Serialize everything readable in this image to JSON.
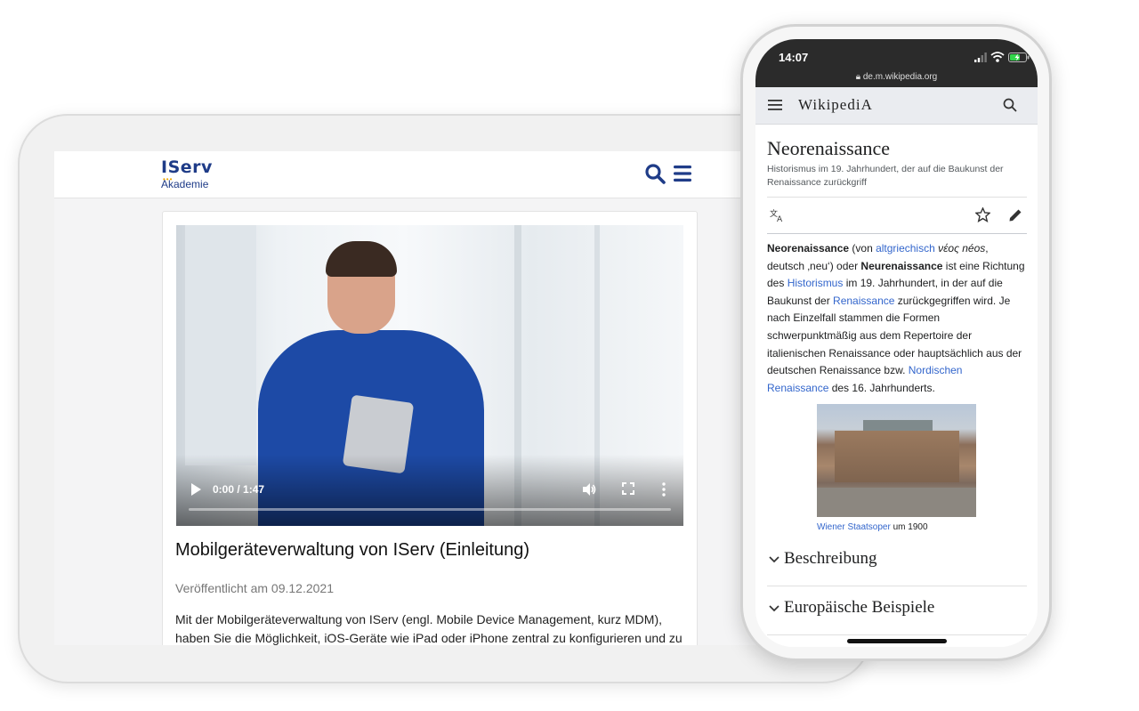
{
  "tablet": {
    "logo_top": "IServ",
    "logo_bottom": "Akademie",
    "video": {
      "time": "0:00 / 1:47",
      "progress": 0.0
    },
    "article": {
      "title": "Mobilgeräteverwaltung von IServ (Einleitung)",
      "date": "Veröffentlicht am 09.12.2021",
      "text": "Mit der Mobilgeräteverwaltung von IServ (engl. Mobile Device Management, kurz MDM), haben Sie die Möglichkeit, iOS-Geräte wie iPad oder iPhone zentral zu konfigurieren und zu"
    },
    "colors": {
      "brand": "#1f3c88",
      "accent": "#f0a800"
    }
  },
  "phone": {
    "status": {
      "time": "14:07",
      "url": "de.m.wikipedia.org"
    },
    "wiki": {
      "logo": "WikipediA",
      "title": "Neorenaissance",
      "subtitle": "Historismus im 19. Jahrhundert, der auf die Baukunst der Renaissance zurückgriff",
      "paragraph": {
        "p1_bold": "Neorenaissance",
        "p2": " (von ",
        "p3_link": "altgriechisch",
        "p4_italic": " νέος néos",
        "p5": ", deutsch ‚neu‘) oder ",
        "p6_bold": "Neurenaissance",
        "p7": " ist eine Richtung des ",
        "p8_link": "Historismus",
        "p9": " im 19. Jahrhundert, in der auf die Baukunst der ",
        "p10_link": "Renaissance",
        "p11": " zurückgegriffen wird. Je nach Einzelfall stammen die Formen schwerpunktmäßig aus dem Repertoire der italienischen Renaissance oder hauptsächlich aus der deutschen Renaissance bzw. ",
        "p12_link": "Nordischen Renaissance",
        "p13": " des 16. Jahrhunderts."
      },
      "caption_link": "Wiener Staatsoper",
      "caption_rest": " um 1900",
      "sections": [
        "Beschreibung",
        "Europäische Beispiele"
      ]
    },
    "colors": {
      "link": "#3366cc",
      "status_bar": "#2b2b2b"
    }
  }
}
